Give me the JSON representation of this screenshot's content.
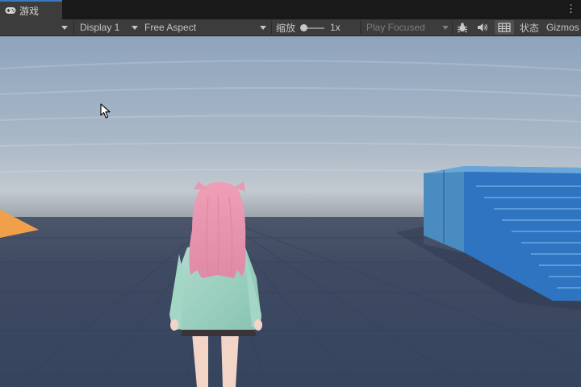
{
  "tab": {
    "label": "游戏",
    "icon": "gamepad-icon"
  },
  "menu": {
    "icon": "more-vertical-icon"
  },
  "toolbar": {
    "display_label": "Display 1",
    "aspect_label": "Free Aspect",
    "scale_label": "缩放",
    "scale_value": "1x",
    "scale_level": 0.15,
    "play_mode_label": "Play Focused",
    "stats_label": "状态",
    "gizmos_label": "Gizmos"
  },
  "icons": {
    "debug": "bug-icon",
    "audio": "speaker-icon",
    "aspect_grid": "grid-icon",
    "cursor": "mouse-pointer-icon"
  },
  "colors": {
    "accent": "#3a79bb",
    "toolbar_bg": "#3c3c3c",
    "tabbar_bg": "#191919",
    "sky_top": "#8ea4bd",
    "ground": "#3e4c66",
    "stairs": "#2f74c0",
    "orange_platform": "#f0a04b",
    "character_hair": "#e89ab2",
    "character_top": "#9fd3c2"
  }
}
